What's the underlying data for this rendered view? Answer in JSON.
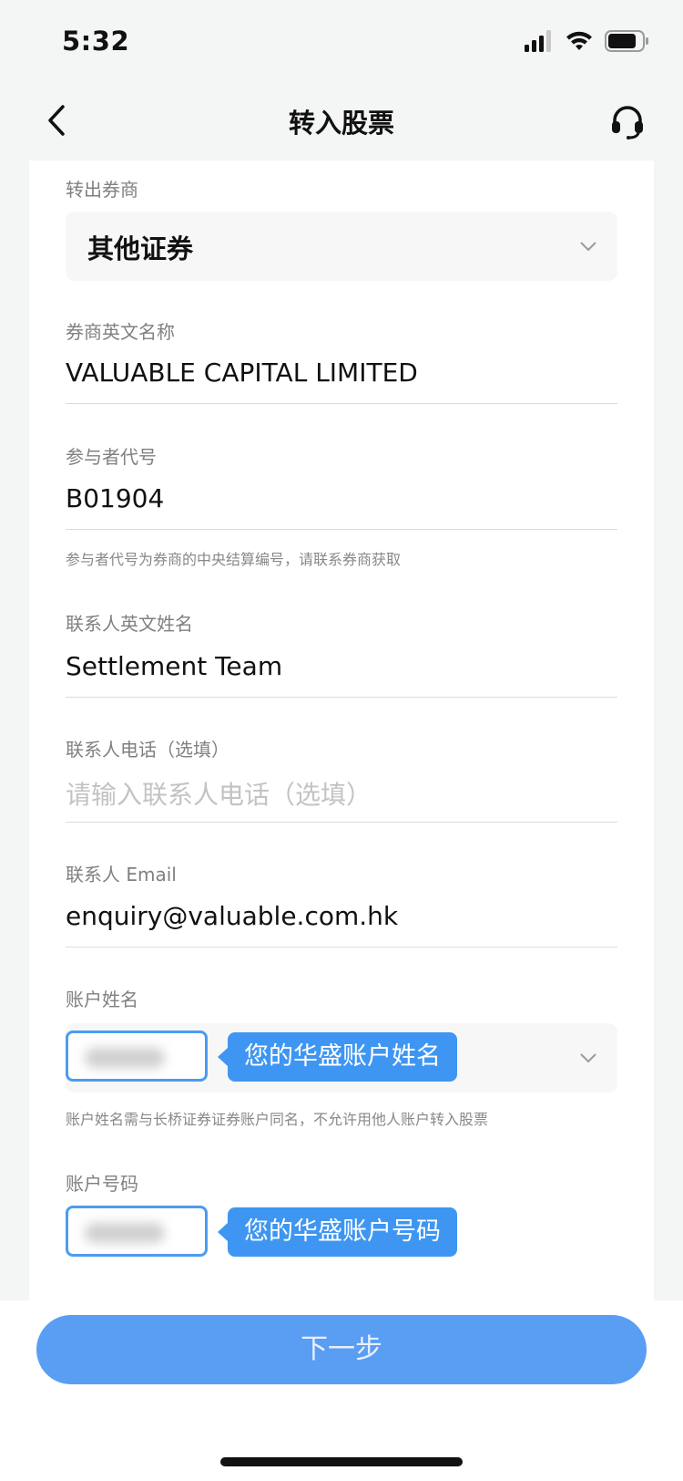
{
  "status": {
    "time": "5:32"
  },
  "header": {
    "title": "转入股票"
  },
  "form": {
    "broker": {
      "label": "转出券商",
      "value": "其他证券"
    },
    "broker_en": {
      "label": "券商英文名称",
      "value": "VALUABLE CAPITAL LIMITED"
    },
    "participant": {
      "label": "参与者代号",
      "value": "B01904",
      "hint": "参与者代号为券商的中央结算编号，请联系券商获取"
    },
    "contact_name": {
      "label": "联系人英文姓名",
      "value": "Settlement Team"
    },
    "contact_phone": {
      "label": "联系人电话（选填）",
      "placeholder": "请输入联系人电话（选填）"
    },
    "contact_email": {
      "label": "联系人 Email",
      "value": "enquiry@valuable.com.hk"
    },
    "account_name": {
      "label": "账户姓名",
      "tooltip": "您的华盛账户姓名",
      "hint": "账户姓名需与长桥证券证券账户同名，不允许用他人账户转入股票"
    },
    "account_number": {
      "label": "账户号码",
      "tooltip": "您的华盛账户号码"
    }
  },
  "footer": {
    "next_label": "下一步"
  },
  "colors": {
    "accent": "#3e96f2",
    "button": "#599ef2",
    "background": "#f4f5f5"
  }
}
